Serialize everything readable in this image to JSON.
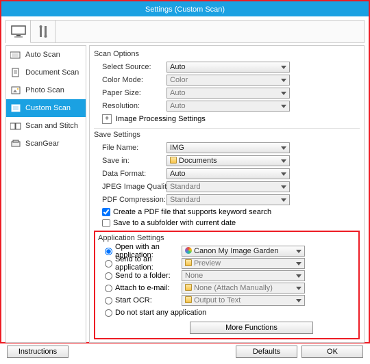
{
  "title": "Settings (Custom Scan)",
  "sidebar": {
    "items": [
      {
        "label": "Auto Scan"
      },
      {
        "label": "Document Scan"
      },
      {
        "label": "Photo Scan"
      },
      {
        "label": "Custom Scan"
      },
      {
        "label": "Scan and Stitch"
      },
      {
        "label": "ScanGear"
      }
    ]
  },
  "scan_options": {
    "title": "Scan Options",
    "select_source_label": "Select Source:",
    "select_source_value": "Auto",
    "color_mode_label": "Color Mode:",
    "color_mode_value": "Color",
    "paper_size_label": "Paper Size:",
    "paper_size_value": "Auto",
    "resolution_label": "Resolution:",
    "resolution_value": "Auto",
    "img_proc_label": "Image Processing Settings"
  },
  "save_settings": {
    "title": "Save Settings",
    "file_name_label": "File Name:",
    "file_name_value": "IMG",
    "save_in_label": "Save in:",
    "save_in_value": "Documents",
    "data_format_label": "Data Format:",
    "data_format_value": "Auto",
    "jpeg_q_label": "JPEG Image Quality:",
    "jpeg_q_value": "Standard",
    "pdf_comp_label": "PDF Compression:",
    "pdf_comp_value": "Standard",
    "chk_keyword": "Create a PDF file that supports keyword search",
    "chk_subfolder": "Save to a subfolder with current date"
  },
  "app_settings": {
    "title": "Application Settings",
    "open_app_label": "Open with an application:",
    "open_app_value": "Canon My Image Garden",
    "send_app_label": "Send to an application:",
    "send_app_value": "Preview",
    "send_folder_label": "Send to a folder:",
    "send_folder_value": "None",
    "attach_label": "Attach to e-mail:",
    "attach_value": "None (Attach Manually)",
    "ocr_label": "Start OCR:",
    "ocr_value": "Output to Text",
    "noapp_label": "Do not start any application",
    "more_fn": "More Functions"
  },
  "footer": {
    "instructions": "Instructions",
    "defaults": "Defaults",
    "ok": "OK"
  }
}
